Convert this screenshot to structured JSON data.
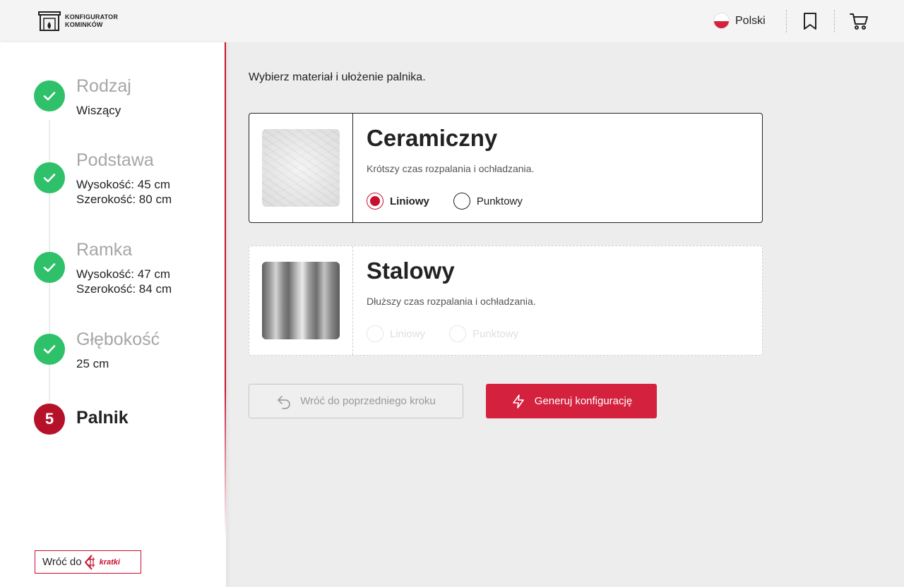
{
  "header": {
    "logo_line1": "KONFIGURATOR",
    "logo_line2": "KOMINKÓW",
    "language": "Polski",
    "icons": [
      "fireplace-logo-icon",
      "poland-flag-icon",
      "bookmark-icon",
      "cart-icon"
    ]
  },
  "steps": [
    {
      "title": "Rodzaj",
      "details": [
        "Wiszący"
      ],
      "status": "done"
    },
    {
      "title": "Podstawa",
      "details": [
        "Wysokość: 45 cm",
        "Szerokość: 80 cm"
      ],
      "status": "done"
    },
    {
      "title": "Ramka",
      "details": [
        "Wysokość: 47 cm",
        "Szerokość: 84 cm"
      ],
      "status": "done"
    },
    {
      "title": "Głębokość",
      "details": [
        "25 cm"
      ],
      "status": "done"
    },
    {
      "title": "Palnik",
      "number": "5",
      "status": "current"
    }
  ],
  "back_kratki": {
    "label": "Wróć do",
    "brand": "kratki"
  },
  "main": {
    "instruction": "Wybierz materiał i ułożenie palnika.",
    "options": [
      {
        "title": "Ceramiczny",
        "description": "Krótszy czas rozpalania i ochładzania.",
        "radios": [
          {
            "label": "Liniowy",
            "checked": true
          },
          {
            "label": "Punktowy",
            "checked": false
          }
        ]
      },
      {
        "title": "Stalowy",
        "description": "Dłuższy czas rozpalania i ochładzania.",
        "radios": [
          {
            "label": "Liniowy",
            "checked": false
          },
          {
            "label": "Punktowy",
            "checked": false
          }
        ]
      }
    ],
    "back_button": "Wróć do poprzedniego kroku",
    "generate_button": "Generuj konfigurację"
  },
  "colors": {
    "accent": "#d4213d",
    "done": "#2ec16a",
    "current": "#b5122a"
  }
}
